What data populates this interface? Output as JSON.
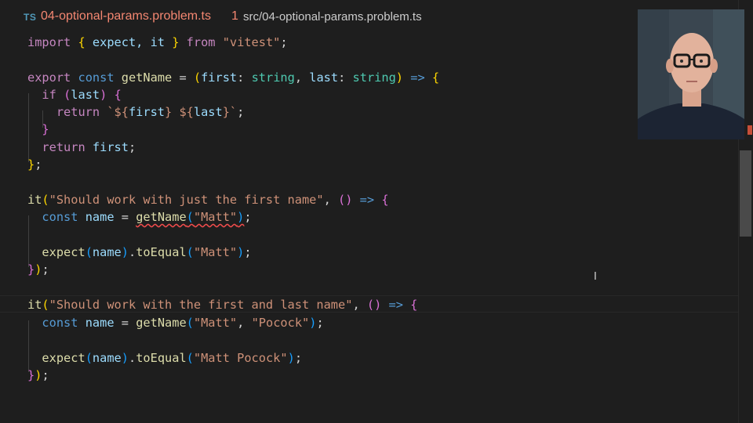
{
  "tab": {
    "lang_badge": "TS",
    "filename": "04-optional-params.problem.ts",
    "problem_count": "1",
    "path": "src/04-optional-params.problem.ts"
  },
  "code": {
    "import_kw": "import",
    "import_names": " expect, it ",
    "from_kw": "from",
    "module": "\"vitest\"",
    "export_kw": "export",
    "const_kw": "const",
    "getName": "getName",
    "param_first": "first",
    "param_last": "last",
    "type_string": "string",
    "if_kw": "if",
    "return_kw": "return",
    "tpl_start": "`${",
    "tpl_mid": "} ${",
    "tpl_end": "}`",
    "it_fn": "it",
    "test1_title": "\"Should work with just the first name\"",
    "test2_title": "\"Should work with the first and last name\"",
    "name_var": "name",
    "matt": "\"Matt\"",
    "pocock": "\"Pocock\"",
    "matt_pocock": "\"Matt Pocock\"",
    "expect_fn": "expect",
    "toEqual_fn": "toEqual"
  },
  "colors": {
    "error": "#f48771",
    "keyword": "#c586c0",
    "storage": "#569cd6",
    "function": "#dcdcaa",
    "variable": "#9cdcfe",
    "type": "#4ec9b0",
    "string": "#ce9178"
  },
  "webcam_icon": "presenter-webcam"
}
